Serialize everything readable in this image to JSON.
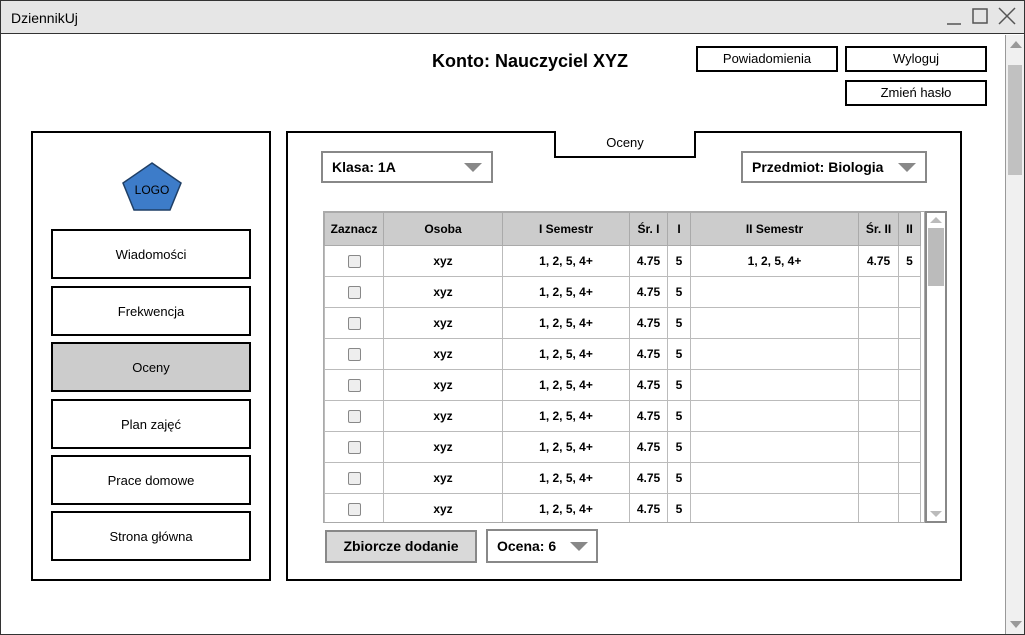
{
  "app": {
    "title": "DziennikUj"
  },
  "window_controls": {
    "minimize": "minimize-icon",
    "maximize": "maximize-icon",
    "close": "close-icon"
  },
  "header": {
    "account_title": "Konto: Nauczyciel XYZ",
    "notifications_label": "Powiadomienia",
    "logout_label": "Wyloguj",
    "change_password_label": "Zmień hasło"
  },
  "sidebar": {
    "logo_text": "LOGO",
    "logo_color": "#3d7cc9",
    "items": [
      {
        "label": "Wiadomości",
        "active": false
      },
      {
        "label": "Frekwencja",
        "active": false
      },
      {
        "label": "Oceny",
        "active": true
      },
      {
        "label": "Plan zajęć",
        "active": false
      },
      {
        "label": "Prace domowe",
        "active": false
      },
      {
        "label": "Strona główna",
        "active": false
      }
    ]
  },
  "main": {
    "tab_label": "Oceny",
    "class_select": "Klasa: 1A",
    "subject_select": "Przedmiot: Biologia",
    "table": {
      "headers": [
        "Zaznacz",
        "Osoba",
        "I Semestr",
        "Śr. I",
        "I",
        "II Semestr",
        "Śr. II",
        "II"
      ],
      "rows": [
        [
          "",
          "xyz",
          "1, 2, 5, 4+",
          "4.75",
          "5",
          "1, 2, 5, 4+",
          "4.75",
          "5"
        ],
        [
          "",
          "xyz",
          "1, 2, 5, 4+",
          "4.75",
          "5",
          "",
          "",
          ""
        ],
        [
          "",
          "xyz",
          "1, 2, 5, 4+",
          "4.75",
          "5",
          "",
          "",
          ""
        ],
        [
          "",
          "xyz",
          "1, 2, 5, 4+",
          "4.75",
          "5",
          "",
          "",
          ""
        ],
        [
          "",
          "xyz",
          "1, 2, 5, 4+",
          "4.75",
          "5",
          "",
          "",
          ""
        ],
        [
          "",
          "xyz",
          "1, 2, 5, 4+",
          "4.75",
          "5",
          "",
          "",
          ""
        ],
        [
          "",
          "xyz",
          "1, 2, 5, 4+",
          "4.75",
          "5",
          "",
          "",
          ""
        ],
        [
          "",
          "xyz",
          "1, 2, 5, 4+",
          "4.75",
          "5",
          "",
          "",
          ""
        ],
        [
          "",
          "xyz",
          "1, 2, 5, 4+",
          "4.75",
          "5",
          "",
          "",
          ""
        ]
      ]
    },
    "bulk_add_label": "Zbiorcze dodanie",
    "grade_select": "Ocena: 6"
  }
}
